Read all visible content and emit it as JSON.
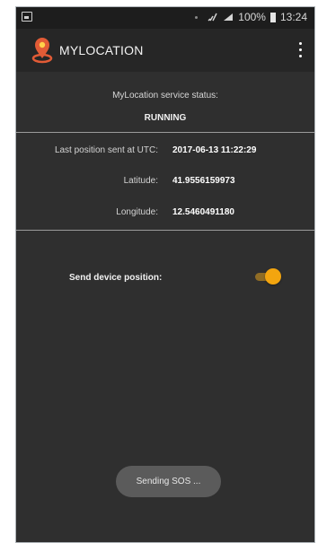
{
  "status_bar": {
    "battery": "100%",
    "time": "13:24",
    "icons": [
      "notification-icon",
      "wifi-icon",
      "signal-icon",
      "battery-icon"
    ]
  },
  "app_bar": {
    "title": "MYLOCATION",
    "logo_icon": "location-pin-icon",
    "menu_icon": "more-vert-icon"
  },
  "service": {
    "label": "MyLocation service status:",
    "value": "RUNNING"
  },
  "details": {
    "last_sent_label": "Last position sent at UTC:",
    "last_sent_value": "2017-06-13 11:22:29",
    "latitude_label": "Latitude:",
    "latitude_value": "41.9556159973",
    "longitude_label": "Longitude:",
    "longitude_value": "12.5460491180"
  },
  "controls": {
    "send_position_label": "Send device position:",
    "send_position_enabled": true
  },
  "toast": {
    "message": "Sending SOS ..."
  },
  "colors": {
    "background": "#2f2f2f",
    "app_bar": "#262626",
    "accent": "#f3a50f",
    "toast": "#5b5b5b"
  }
}
